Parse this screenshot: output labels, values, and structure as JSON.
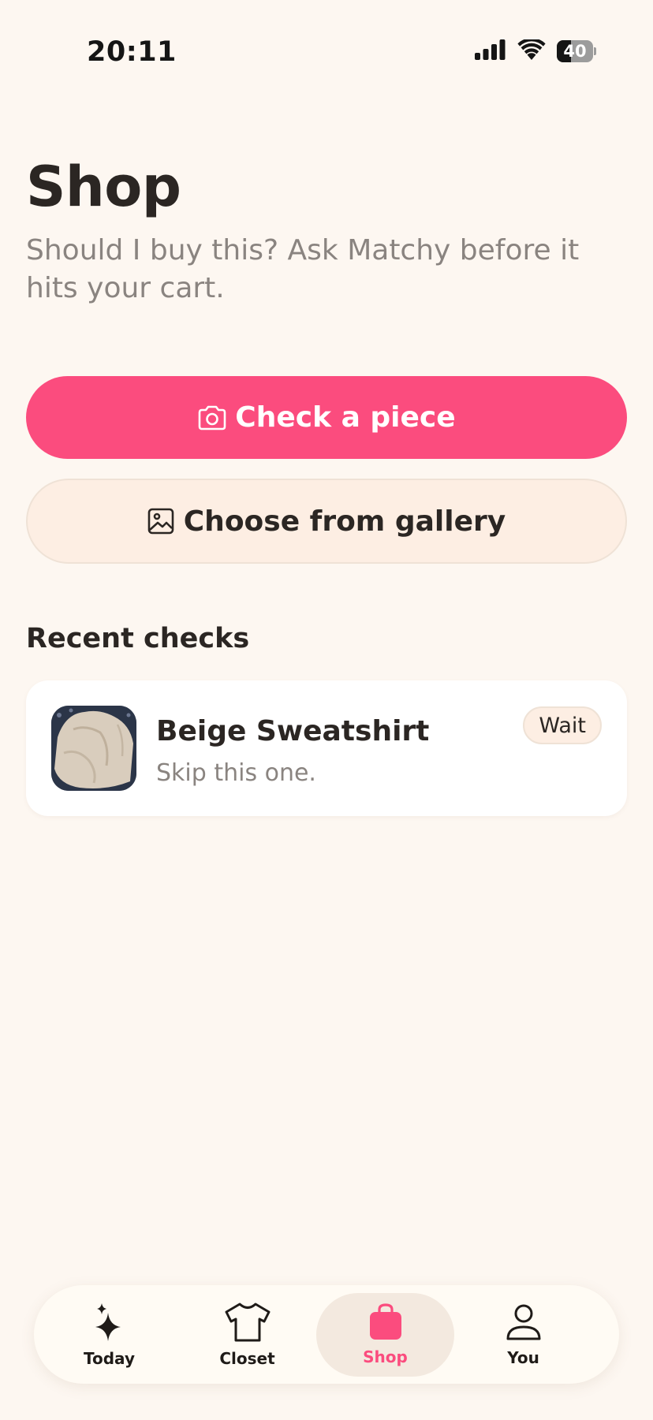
{
  "status_bar": {
    "time": "20:11",
    "battery_level": "40",
    "icons": [
      "signal-icon",
      "wifi-icon",
      "battery-icon"
    ]
  },
  "header": {
    "title": "Shop",
    "subtitle": "Should I buy this? Ask Matchy before it hits your cart."
  },
  "actions": {
    "check_label": "Check a piece",
    "check_icon": "camera-icon",
    "gallery_label": "Choose from gallery",
    "gallery_icon": "image-icon"
  },
  "recent": {
    "heading": "Recent checks",
    "items": [
      {
        "name": "Beige Sweatshirt",
        "verdict": "Skip this one.",
        "badge": "Wait"
      }
    ]
  },
  "tabbar": {
    "tabs": [
      {
        "label": "Today",
        "icon": "sparkles-icon",
        "active": false
      },
      {
        "label": "Closet",
        "icon": "tshirt-icon",
        "active": false
      },
      {
        "label": "Shop",
        "icon": "shopping-bag-icon",
        "active": true
      },
      {
        "label": "You",
        "icon": "person-icon",
        "active": false
      }
    ]
  },
  "colors": {
    "background": "#FDF7F1",
    "accent": "#FB4C7E",
    "secondary_button": "#FDEEE3",
    "text_primary": "#2B2623",
    "text_muted": "#8A8480"
  }
}
